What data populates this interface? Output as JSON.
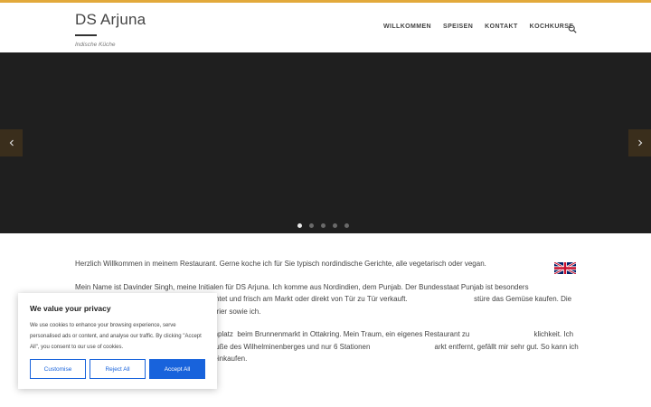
{
  "colors": {
    "accent": "#e2a93b",
    "slider_bg": "#1f1f1f",
    "cookie_primary": "#1863dc"
  },
  "site": {
    "title": "DS Arjuna",
    "tagline": "Indische Küche"
  },
  "nav": {
    "items": [
      "WILLKOMMEN",
      "SPEISEN",
      "KONTAKT",
      "KOCHKURSE"
    ],
    "search_icon": "search-icon"
  },
  "slider": {
    "dot_count": 5,
    "active_index": 0,
    "prev_icon": "chevron-left-icon",
    "next_icon": "chevron-right-icon"
  },
  "content": {
    "paragraphs": [
      "Herzlich Willkommen in meinem Restaurant. Gerne koche ich für Sie typisch nordindische Gerichte, alle vegetarisch oder vegan.",
      "Mein Name ist Davinder Singh, meine Initialen für DS Arjuna. Ich komme aus Nordindien, dem Punjab. Der Bundesstaat Punjab ist besonders                                 lerbare Vielfalt an Gemüse wird täglich geerntet und frisch am Markt oder direkt von Tür zu Tür verkauft.                                 stüre das Gemüse kaufen. Die meisten Einwohner vom Punjab sind Vegetarier sowie ich.",
      "                                urant „Arjuna“ am Yppenplatz  beim Brunnenmarkt in Ottakring. Mein Traum, ein eigenes Restaurant zu                                klichkeit. Ich bin Ottakring treu geblieben. Die Lage am Fuße des Wilhelminenberges und nur 6 Stationen                                arkt entfernt, gefällt mir sehr gut. So kann ich täglich frisches Gemüse am Brunnenmarkt einkaufen."
    ],
    "flag_icon": "uk-flag-icon"
  },
  "cookie": {
    "title": "We value your privacy",
    "text": "We use cookies to enhance your browsing experience, serve personalised ads or content, and analyse our traffic. By clicking \"Accept All\", you consent to our use of cookies.",
    "customise_label": "Customise",
    "reject_label": "Reject All",
    "accept_label": "Accept All"
  }
}
